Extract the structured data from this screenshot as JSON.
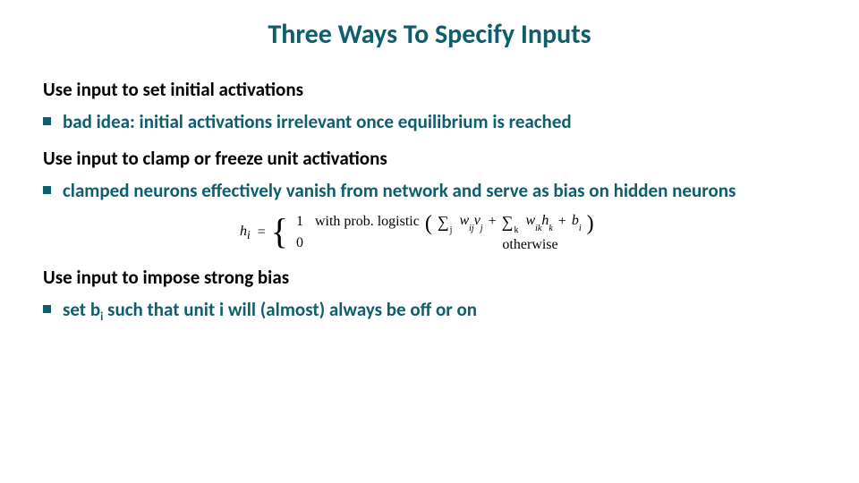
{
  "title": "Three Ways To Specify Inputs",
  "sections": {
    "s1": {
      "head": "Use input to set initial activations",
      "bullet": "bad idea: initial activations irrelevant once equilibrium is reached"
    },
    "s2": {
      "head": "Use input to clamp or freeze unit activations",
      "bullet": "clamped neurons effectively vanish from network and serve as bias on hidden neurons"
    },
    "s3": {
      "head": "Use input to impose strong bias",
      "bullet_prefix": "set b",
      "bullet_sub": "i",
      "bullet_suffix": " such that unit i will (almost) always be off or on"
    }
  },
  "formula": {
    "lhs_var": "h",
    "lhs_sub": "i",
    "case1_val": "1",
    "case1_cond_prefix": "with prob. logistic",
    "sum1_index": "j",
    "sum1_term_w": "w",
    "sum1_term_wsub": "ij",
    "sum1_term_v": "v",
    "sum1_term_vsub": "j",
    "sum2_index": "k",
    "sum2_term_w": "w",
    "sum2_term_wsub": "ik",
    "sum2_term_h": "h",
    "sum2_term_hsub": "k",
    "bias_var": "b",
    "bias_sub": "i",
    "case2_val": "0",
    "case2_cond": "otherwise"
  }
}
